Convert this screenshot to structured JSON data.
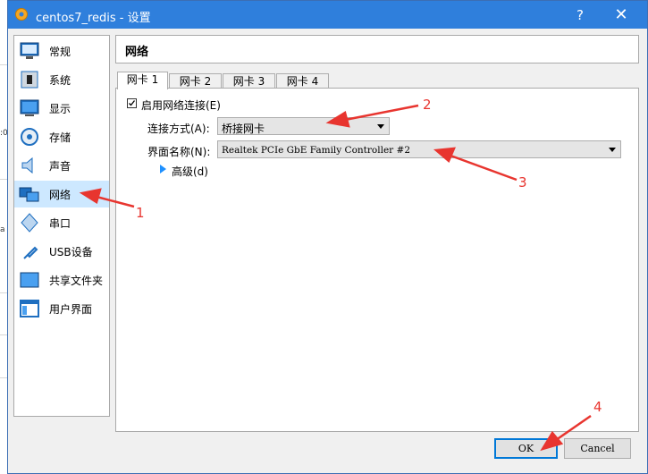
{
  "window": {
    "title": "centos7_redis - 设置",
    "help_glyph": "?",
    "close_glyph": "✕"
  },
  "sidebar": {
    "items": [
      {
        "label": "常规",
        "icon": "monitor-icon"
      },
      {
        "label": "系统",
        "icon": "chip-icon"
      },
      {
        "label": "显示",
        "icon": "display-icon"
      },
      {
        "label": "存储",
        "icon": "disk-icon"
      },
      {
        "label": "声音",
        "icon": "speaker-icon"
      },
      {
        "label": "网络",
        "icon": "network-icon",
        "selected": true
      },
      {
        "label": "串口",
        "icon": "serial-port-icon"
      },
      {
        "label": "USB设备",
        "icon": "usb-icon"
      },
      {
        "label": "共享文件夹",
        "icon": "folder-icon"
      },
      {
        "label": "用户界面",
        "icon": "window-layout-icon"
      }
    ]
  },
  "page": {
    "title": "网络",
    "tabs": [
      "网卡 1",
      "网卡 2",
      "网卡 3",
      "网卡 4"
    ],
    "enable_label": "启用网络连接(E)",
    "enable_checked": true,
    "attached_label": "连接方式(A):",
    "attached_value": "桥接网卡",
    "name_label": "界面名称(N):",
    "name_value": "Realtek PCIe GbE Family Controller #2",
    "advanced_label": "高级(d)"
  },
  "buttons": {
    "ok": "OK",
    "cancel": "Cancel"
  },
  "annotations": [
    "1",
    "2",
    "3",
    "4"
  ],
  "colors": {
    "titlebar": "#2f7fdc",
    "selection": "#cde8ff",
    "annotation": "#e8352f"
  }
}
